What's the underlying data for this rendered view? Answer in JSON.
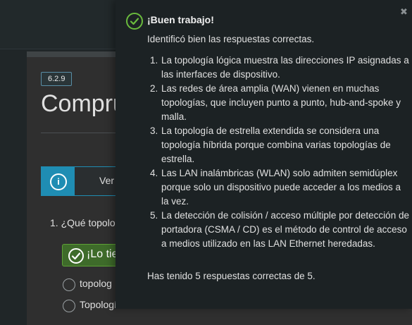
{
  "colors": {
    "accent_blue": "#1f8db3",
    "success_green": "#6abb3d",
    "popup_bg": "#1c2224",
    "page_bg": "#2f2f2f"
  },
  "page": {
    "version_badge": "6.2.9",
    "title": "Comprue",
    "info_text": "Ver",
    "question": "1. ¿Qué topolo",
    "feedback_tag": "¡Lo tie",
    "options": [
      {
        "label": "topolog"
      },
      {
        "label": "Topología de direcciones IP"
      }
    ]
  },
  "popup": {
    "close_icon_glyph": "✖",
    "title": "¡Buen trabajo!",
    "intro": "Identificó bien las respuestas correctas.",
    "answers": [
      "La topología lógica muestra las direcciones IP asignadas a las interfaces de dispositivo.",
      "Las redes de área amplia (WAN) vienen en muchas topologías, que incluyen punto a punto, hub-and-spoke y malla.",
      "La topología de estrella extendida se considera una topología híbrida porque combina varias topologías de estrella.",
      "Las LAN inalámbricas (WLAN) solo admiten semidúplex porque solo un dispositivo puede acceder a los medios a la vez.",
      "La detección de colisión / acceso múltiple por detección de portadora (CSMA / CD) es el método de control de acceso a medios utilizado en las LAN Ethernet heredadas."
    ],
    "summary": "Has tenido 5 respuestas correctas de 5."
  }
}
